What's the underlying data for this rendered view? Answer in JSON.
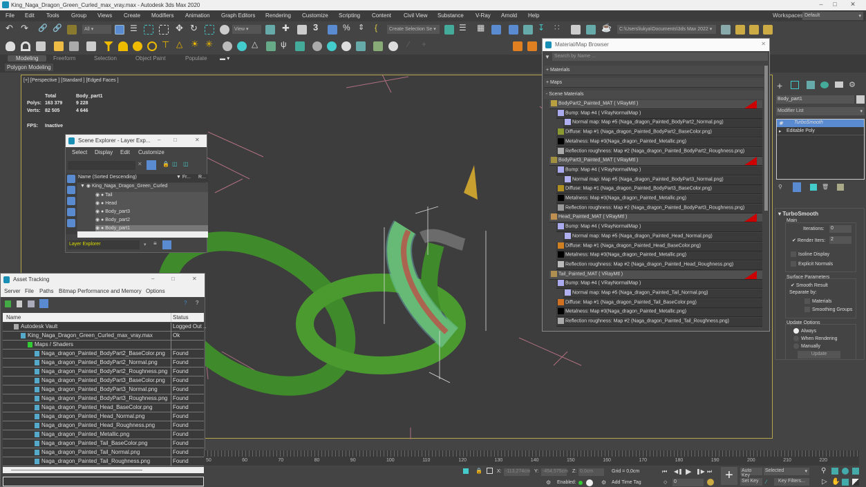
{
  "window": {
    "title": "King_Naga_Dragon_Green_Curled_max_vray.max - Autodesk 3ds Max 2020"
  },
  "menu": [
    "File",
    "Edit",
    "Tools",
    "Group",
    "Views",
    "Create",
    "Modifiers",
    "Animation",
    "Graph Editors",
    "Rendering",
    "Customize",
    "Scripting",
    "Content",
    "Civil View",
    "Substance",
    "V-Ray",
    "Arnold",
    "Help"
  ],
  "workspaces": {
    "label": "Workspaces:",
    "value": "Default"
  },
  "toolbar": {
    "filter_all": "All",
    "view_dropdown": "View",
    "selection_set": "Create Selection Se",
    "project_path": "C:\\Users\\lukya\\Documents\\3ds Max 2022"
  },
  "ribbon": {
    "tabs": [
      "Modeling",
      "Freeform",
      "Selection",
      "Object Paint",
      "Populate"
    ],
    "active": "Modeling",
    "sub": "Polygon Modeling"
  },
  "viewport": {
    "label": "[+] [Perspective ] [Standard ] [Edged Faces ]",
    "stats": {
      "h_total": "Total",
      "h_obj": "Body_part1",
      "polys_label": "Polys:",
      "polys_total": "163 379",
      "polys_obj": "9 228",
      "verts_label": "Verts:",
      "verts_total": "82 505",
      "verts_obj": "4 646",
      "fps_label": "FPS:",
      "fps_value": "Inactive"
    }
  },
  "scene_explorer": {
    "title": "Scene Explorer - Layer Exp...",
    "menu": [
      "Select",
      "Display",
      "Edit",
      "Customize"
    ],
    "columns": {
      "name": "Name (Sorted Descending)",
      "fr": "▼ Fr...",
      "r": "R..."
    },
    "root": "King_Naga_Dragon_Green_Curled",
    "items": [
      "Tail",
      "Head",
      "Body_part3",
      "Body_part2",
      "Body_part1"
    ],
    "footer": "Layer Explorer"
  },
  "asset_tracking": {
    "title": "Asset Tracking",
    "menu": [
      "Server",
      "File",
      "Paths",
      "Bitmap Performance and Memory",
      "Options"
    ],
    "columns": {
      "name": "Name",
      "status": "Status"
    },
    "rows": [
      {
        "name": "Autodesk Vault",
        "status": "Logged Out ..",
        "indent": 1
      },
      {
        "name": "King_Naga_Dragon_Green_Curled_max_vray.max",
        "status": "Ok",
        "indent": 2
      },
      {
        "name": "Maps / Shaders",
        "status": "",
        "indent": 3
      },
      {
        "name": "Naga_dragon_Painted_BodyPart2_BaseColor.png",
        "status": "Found",
        "indent": 4
      },
      {
        "name": "Naga_dragon_Painted_BodyPart2_Normal.png",
        "status": "Found",
        "indent": 4
      },
      {
        "name": "Naga_dragon_Painted_BodyPart2_Roughness.png",
        "status": "Found",
        "indent": 4
      },
      {
        "name": "Naga_dragon_Painted_BodyPart3_BaseColor.png",
        "status": "Found",
        "indent": 4
      },
      {
        "name": "Naga_dragon_Painted_BodyPart3_Normal.png",
        "status": "Found",
        "indent": 4
      },
      {
        "name": "Naga_dragon_Painted_BodyPart3_Roughness.png",
        "status": "Found",
        "indent": 4
      },
      {
        "name": "Naga_dragon_Painted_Head_BaseColor.png",
        "status": "Found",
        "indent": 4
      },
      {
        "name": "Naga_dragon_Painted_Head_Normal.png",
        "status": "Found",
        "indent": 4
      },
      {
        "name": "Naga_dragon_Painted_Head_Roughness.png",
        "status": "Found",
        "indent": 4
      },
      {
        "name": "Naga_dragon_Painted_Metallic.png",
        "status": "Found",
        "indent": 4
      },
      {
        "name": "Naga_dragon_Painted_Tail_BaseColor.png",
        "status": "Found",
        "indent": 4
      },
      {
        "name": "Naga_dragon_Painted_Tail_Normal.png",
        "status": "Found",
        "indent": 4
      },
      {
        "name": "Naga_dragon_Painted_Tail_Roughness.png",
        "status": "Found",
        "indent": 4
      }
    ]
  },
  "material_browser": {
    "title": "Material/Map Browser",
    "search_placeholder": "Search by Name ...",
    "sections": [
      "+ Materials",
      "+ Maps",
      "- Scene Materials"
    ],
    "rows": [
      {
        "text": "BodyPart2_Painted_MAT  ( VRayMtl )",
        "level": 0,
        "swatch": "#b8a040",
        "tag": true
      },
      {
        "text": "Bump: Map #4  ( VRayNormalMap )",
        "level": 1,
        "swatch": "#aaaaee"
      },
      {
        "text": "Normal map: Map #5 (Naga_dragon_Painted_BodyPart2_Normal.png)",
        "level": 2,
        "swatch": "#b0b0f0"
      },
      {
        "text": "Diffuse: Map #1 (Naga_dragon_Painted_BodyPart2_BaseColor.png)",
        "level": 1,
        "swatch": "#8a9a30"
      },
      {
        "text": "Metalness: Map #3(Naga_dragon_Painted_Metallic.png)",
        "level": 1,
        "swatch": "#000000"
      },
      {
        "text": "Reflection roughness: Map #2 (Naga_dragon_Painted_BodyPart2_Roughness.png)",
        "level": 1,
        "swatch": "#aaaaaa"
      },
      {
        "text": "BodyPart3_Painted_MAT  ( VRayMtl )",
        "level": 0,
        "swatch": "#a09040",
        "tag": true
      },
      {
        "text": "Bump: Map #4  ( VRayNormalMap )",
        "level": 1,
        "swatch": "#aaaaee"
      },
      {
        "text": "Normal map: Map #5 (Naga_dragon_Painted_BodyPart3_Normal.png)",
        "level": 2,
        "swatch": "#b0b0f0"
      },
      {
        "text": "Diffuse: Map #1 (Naga_dragon_Painted_BodyPart3_BaseColor.png)",
        "level": 1,
        "swatch": "#b09020"
      },
      {
        "text": "Metalness: Map #3(Naga_dragon_Painted_Metallic.png)",
        "level": 1,
        "swatch": "#000000"
      },
      {
        "text": "Reflection roughness: Map #2 (Naga_dragon_Painted_BodyPart3_Roughness.png)",
        "level": 1,
        "swatch": "#999999"
      },
      {
        "text": "Head_Painted_MAT  ( VRayMtl )",
        "level": 0,
        "swatch": "#c09050",
        "tag": true
      },
      {
        "text": "Bump: Map #4  ( VRayNormalMap )",
        "level": 1,
        "swatch": "#aaaaee"
      },
      {
        "text": "Normal map: Map #5 (Naga_dragon_Painted_Head_Normal.png)",
        "level": 2,
        "swatch": "#b0b0f0"
      },
      {
        "text": "Diffuse: Map #1 (Naga_dragon_Painted_Head_BaseColor.png)",
        "level": 1,
        "swatch": "#d08020"
      },
      {
        "text": "Metalness: Map #3(Naga_dragon_Painted_Metallic.png)",
        "level": 1,
        "swatch": "#000000"
      },
      {
        "text": "Reflection roughness: Map #2 (Naga_dragon_Painted_Head_Roughness.png)",
        "level": 1,
        "swatch": "#bbbbbb"
      },
      {
        "text": "Tail_Painted_MAT  ( VRayMtl )",
        "level": 0,
        "swatch": "#b09050",
        "tag": true
      },
      {
        "text": "Bump: Map #4  ( VRayNormalMap )",
        "level": 1,
        "swatch": "#aaaaee"
      },
      {
        "text": "Normal map: Map #5 (Naga_dragon_Painted_Tail_Normal.png)",
        "level": 2,
        "swatch": "#b0b0f0"
      },
      {
        "text": "Diffuse: Map #1 (Naga_dragon_Painted_Tail_BaseColor.png)",
        "level": 1,
        "swatch": "#d07020"
      },
      {
        "text": "Metalness: Map #3(Naga_dragon_Painted_Metallic.png)",
        "level": 1,
        "swatch": "#000000"
      },
      {
        "text": "Reflection roughness: Map #2 (Naga_dragon_Painted_Tail_Roughness.png)",
        "level": 1,
        "swatch": "#aaaaaa"
      }
    ]
  },
  "command_panel": {
    "object_name": "Body_part1",
    "modifier_list": "Modifier List",
    "stack": [
      "TurboSmooth",
      "Editable Poly"
    ],
    "rollout_title": "TurboSmooth",
    "main_group": "Main",
    "iterations_label": "Iterations:",
    "iterations_value": "0",
    "render_iters_label": "Render Iters:",
    "render_iters_value": "2",
    "render_iters_checked": true,
    "isoline_label": "Isoline Display",
    "isoline_checked": false,
    "explicit_label": "Explicit Normals",
    "explicit_checked": false,
    "surface_group": "Surface Parameters",
    "smooth_result_label": "Smooth Result",
    "smooth_result_checked": true,
    "separate_by_label": "Separate by:",
    "materials_label": "Materials",
    "materials_checked": false,
    "smoothing_groups_label": "Smoothing Groups",
    "smoothing_groups_checked": false,
    "update_group": "Update Options",
    "update_options": [
      "Always",
      "When Rendering",
      "Manually"
    ],
    "update_selected": "Always",
    "update_button": "Update"
  },
  "timeline": {
    "ticks": [
      "50",
      "60",
      "70",
      "80",
      "90",
      "100",
      "110",
      "120",
      "130",
      "140",
      "150",
      "160",
      "170",
      "180",
      "190",
      "200",
      "210",
      "220"
    ]
  },
  "statusbar": {
    "x_label": "X:",
    "x_value": "-113,274cm",
    "y_label": "Y:",
    "y_value": "-454,575cm",
    "z_label": "Z:",
    "z_value": "0,0cm",
    "grid": "Grid = 0,0cm",
    "enabled_label": "Enabled:",
    "add_time_tag": "Add Time Tag",
    "frame_value": "0",
    "auto_key": "Auto Key",
    "set_key": "Set Key",
    "key_mode": "Selected",
    "key_filters": "Key Filters..."
  }
}
